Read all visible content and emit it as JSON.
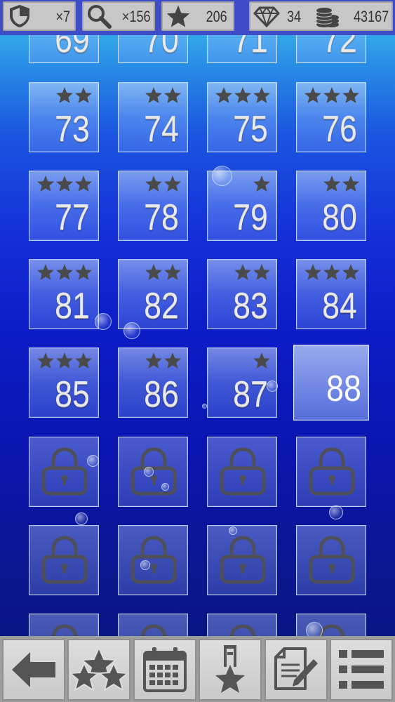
{
  "hud": {
    "shields": "×7",
    "hints": "×156",
    "stars": "206",
    "gems": "34",
    "coins": "43167",
    "icons": [
      "shield-icon",
      "magnifier-icon",
      "star-icon",
      "diamond-icon",
      "coin-stack-icon"
    ]
  },
  "levels": {
    "partial_row": [
      "69",
      "70",
      "71",
      "72"
    ],
    "tiles": [
      {
        "num": "73",
        "stars": 2
      },
      {
        "num": "74",
        "stars": 2
      },
      {
        "num": "75",
        "stars": 3
      },
      {
        "num": "76",
        "stars": 3
      },
      {
        "num": "77",
        "stars": 3
      },
      {
        "num": "78",
        "stars": 2
      },
      {
        "num": "79",
        "stars": 1
      },
      {
        "num": "80",
        "stars": 2
      },
      {
        "num": "81",
        "stars": 3
      },
      {
        "num": "82",
        "stars": 2
      },
      {
        "num": "83",
        "stars": 2
      },
      {
        "num": "84",
        "stars": 3
      },
      {
        "num": "85",
        "stars": 3
      },
      {
        "num": "86",
        "stars": 2
      },
      {
        "num": "87",
        "stars": 1
      },
      {
        "num": "88",
        "stars": 0,
        "current": true
      }
    ],
    "locked_rows": 2,
    "star_color": "#4a4a4a",
    "lock_color": "#4f4f5a"
  },
  "toolbar": {
    "buttons": [
      "back-button",
      "stars-button",
      "calendar-button",
      "leaderboard-button",
      "notes-button",
      "menu-button"
    ]
  }
}
